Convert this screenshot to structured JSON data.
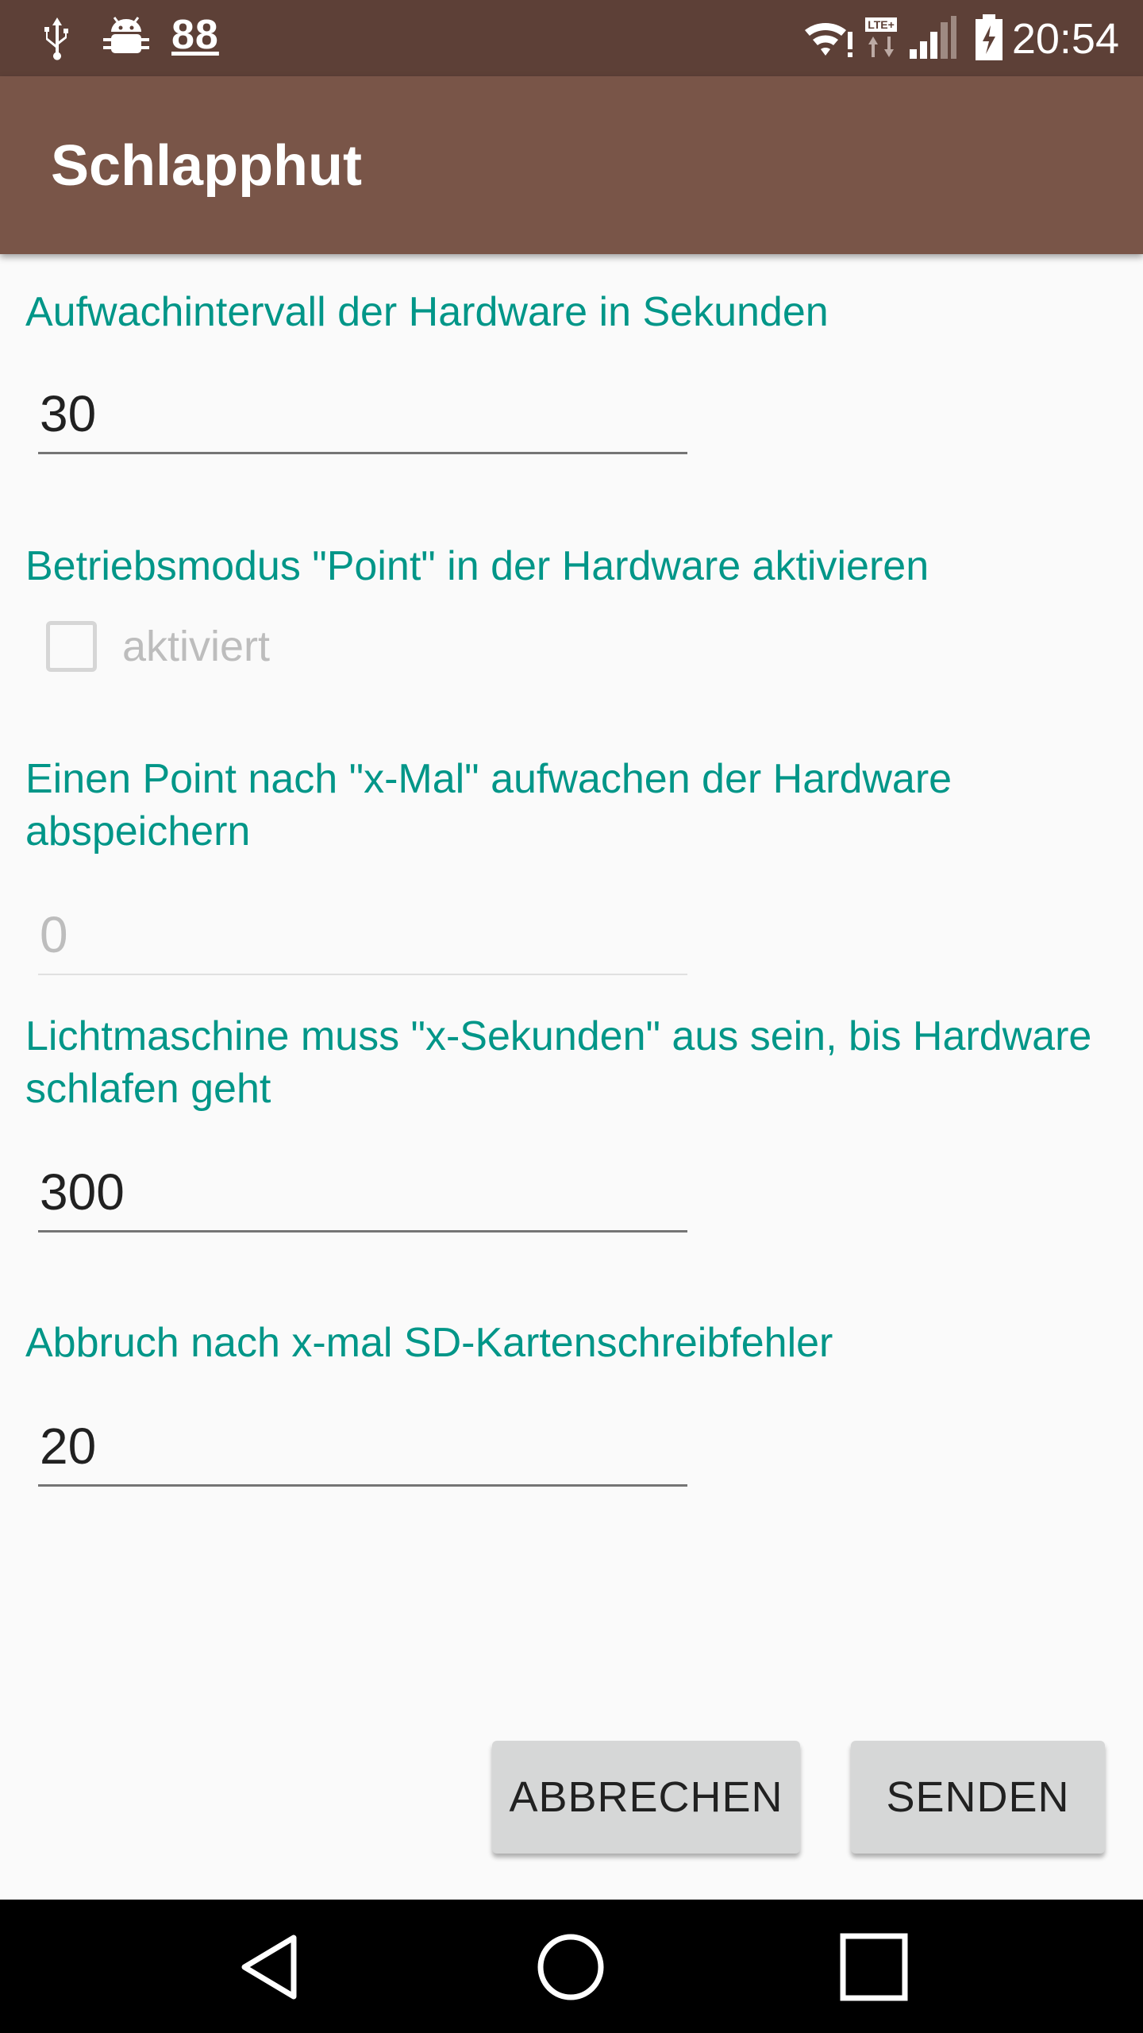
{
  "status_bar": {
    "notification_count": "88",
    "time": "20:54",
    "icons": [
      "usb-icon",
      "android-debug-icon",
      "wifi-icon",
      "lte-icon",
      "signal-icon",
      "battery-charging-icon"
    ]
  },
  "app_bar": {
    "title": "Schlapphut"
  },
  "form": {
    "wake_interval": {
      "label": "Aufwachintervall der Hardware in Sekunden",
      "value": "30"
    },
    "point_mode": {
      "label": "Betriebsmodus \"Point\" in der Hardware aktivieren",
      "checkbox_label": "aktiviert",
      "checked": false
    },
    "point_save": {
      "label_line1": "Einen Point nach \"x-Mal\" aufwachen der Hardware",
      "label_line2": "abspeichern",
      "value": "0"
    },
    "alternator_off": {
      "label_line1": "Lichtmaschine muss \"x-Sekunden\" aus sein, bis Hardware",
      "label_line2": "schlafen geht",
      "value": "300"
    },
    "sd_error": {
      "label": "Abbruch nach x-mal SD-Kartenschreibfehler",
      "value": "20"
    }
  },
  "buttons": {
    "cancel_label": "ABBRECHEN",
    "send_label": "SENDEN"
  },
  "colors": {
    "status_bar": "#5d4037",
    "app_bar": "#795548",
    "accent": "#009688",
    "background": "#fafafa"
  },
  "nav_bar": {
    "icons": [
      "back-icon",
      "home-icon",
      "recent-apps-icon"
    ]
  }
}
